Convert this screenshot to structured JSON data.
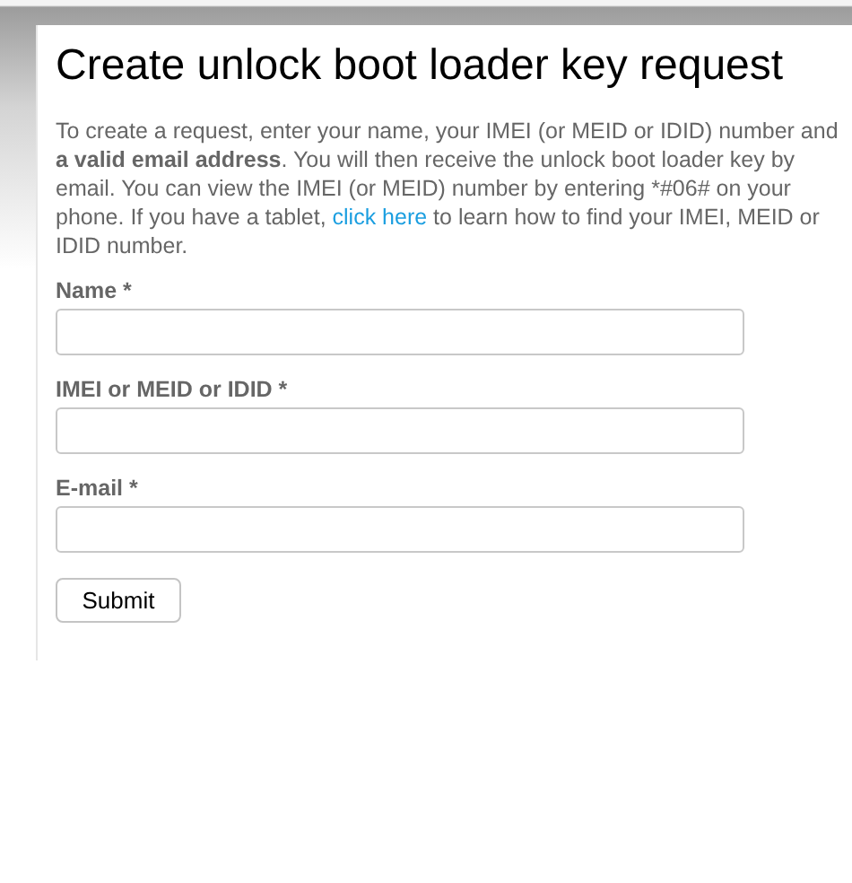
{
  "title": "Create unlock boot loader key request",
  "intro": {
    "before": "To create a request, enter your name, your IMEI (or MEID or IDID) number and **a valid email address**. You will then receive the unlock boot loader key by email. You can view the IMEI (or MEID) number by entering *#06# on your phone. If you have a tablet, ",
    "link": "click here",
    "after": " to learn how to find your IMEI, MEID or IDID number."
  },
  "fields": [
    {
      "label": "Name *"
    },
    {
      "label": "IMEI or MEID or IDID *"
    },
    {
      "label": "E-mail *"
    }
  ],
  "submit": "Submit"
}
